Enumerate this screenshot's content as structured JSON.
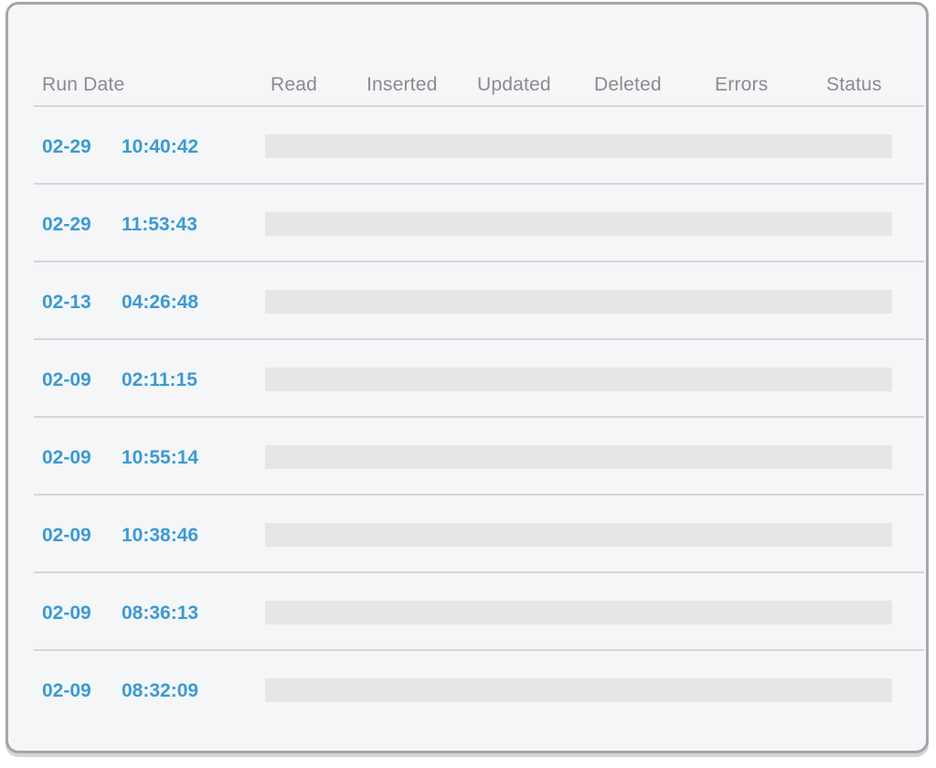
{
  "columns": {
    "run_date": "Run Date",
    "read": "Read",
    "inserted": "Inserted",
    "updated": "Updated",
    "deleted": "Deleted",
    "errors": "Errors",
    "status": "Status"
  },
  "rows": [
    {
      "date": "02-29",
      "time": "10:40:42"
    },
    {
      "date": "02-29",
      "time": "11:53:43"
    },
    {
      "date": "02-13",
      "time": "04:26:48"
    },
    {
      "date": "02-09",
      "time": "02:11:15"
    },
    {
      "date": "02-09",
      "time": "10:55:14"
    },
    {
      "date": "02-09",
      "time": "10:38:46"
    },
    {
      "date": "02-09",
      "time": "08:36:13"
    },
    {
      "date": "02-09",
      "time": "08:32:09"
    }
  ],
  "colors": {
    "accent": "#3b9ad3",
    "header_text": "#8a8b8e",
    "placeholder_bar": "#e5e6e8",
    "divider": "#d4d5d8",
    "panel_bg": "#f5f6f8",
    "panel_border": "#a5a6a9"
  }
}
